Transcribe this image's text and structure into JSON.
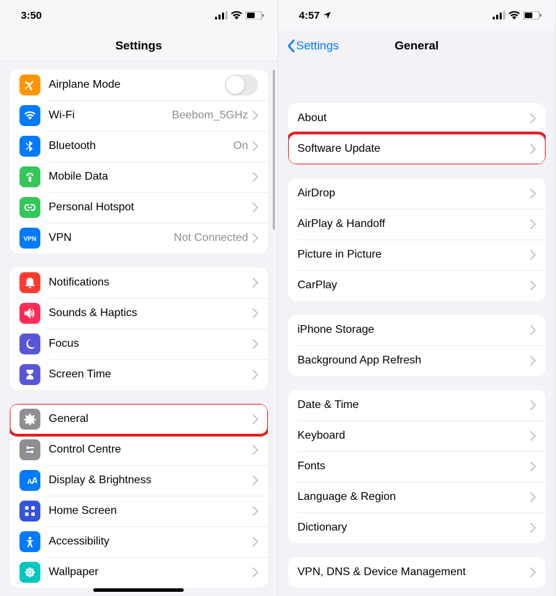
{
  "left": {
    "status": {
      "time": "3:50"
    },
    "nav": {
      "title": "Settings"
    },
    "groups": [
      [
        {
          "icon": "airplane",
          "color": "#ff9500",
          "label": "Airplane Mode",
          "control": "toggle"
        },
        {
          "icon": "wifi",
          "color": "#007aff",
          "label": "Wi-Fi",
          "value": "Beebom_5GHz",
          "control": "chev"
        },
        {
          "icon": "bluetooth",
          "color": "#007aff",
          "label": "Bluetooth",
          "value": "On",
          "control": "chev"
        },
        {
          "icon": "antenna",
          "color": "#34c759",
          "label": "Mobile Data",
          "control": "chev"
        },
        {
          "icon": "link",
          "color": "#34c759",
          "label": "Personal Hotspot",
          "control": "chev"
        },
        {
          "icon": "vpn",
          "color": "#007aff",
          "label": "VPN",
          "value": "Not Connected",
          "control": "chev"
        }
      ],
      [
        {
          "icon": "bell",
          "color": "#ff3b30",
          "label": "Notifications",
          "control": "chev"
        },
        {
          "icon": "speaker",
          "color": "#ff2d55",
          "label": "Sounds & Haptics",
          "control": "chev"
        },
        {
          "icon": "moon",
          "color": "#5856d6",
          "label": "Focus",
          "control": "chev"
        },
        {
          "icon": "hourglass",
          "color": "#5856d6",
          "label": "Screen Time",
          "control": "chev"
        }
      ],
      [
        {
          "icon": "gear",
          "color": "#8e8e93",
          "label": "General",
          "control": "chev",
          "highlight": true
        },
        {
          "icon": "switches",
          "color": "#8e8e93",
          "label": "Control Centre",
          "control": "chev"
        },
        {
          "icon": "textsize",
          "color": "#007aff",
          "label": "Display & Brightness",
          "control": "chev"
        },
        {
          "icon": "grid",
          "color": "#3355dd",
          "label": "Home Screen",
          "control": "chev"
        },
        {
          "icon": "accessibility",
          "color": "#007aff",
          "label": "Accessibility",
          "control": "chev"
        },
        {
          "icon": "flower",
          "color": "#00c7be",
          "label": "Wallpaper",
          "control": "chev"
        }
      ]
    ]
  },
  "right": {
    "status": {
      "time": "4:57"
    },
    "nav": {
      "back": "Settings",
      "title": "General"
    },
    "groups": [
      [
        {
          "label": "About",
          "control": "chev"
        },
        {
          "label": "Software Update",
          "control": "chev",
          "highlight": true
        }
      ],
      [
        {
          "label": "AirDrop",
          "control": "chev"
        },
        {
          "label": "AirPlay & Handoff",
          "control": "chev"
        },
        {
          "label": "Picture in Picture",
          "control": "chev"
        },
        {
          "label": "CarPlay",
          "control": "chev"
        }
      ],
      [
        {
          "label": "iPhone Storage",
          "control": "chev"
        },
        {
          "label": "Background App Refresh",
          "control": "chev"
        }
      ],
      [
        {
          "label": "Date & Time",
          "control": "chev"
        },
        {
          "label": "Keyboard",
          "control": "chev"
        },
        {
          "label": "Fonts",
          "control": "chev"
        },
        {
          "label": "Language & Region",
          "control": "chev"
        },
        {
          "label": "Dictionary",
          "control": "chev"
        }
      ],
      [
        {
          "label": "VPN, DNS & Device Management",
          "control": "chev"
        }
      ]
    ]
  }
}
